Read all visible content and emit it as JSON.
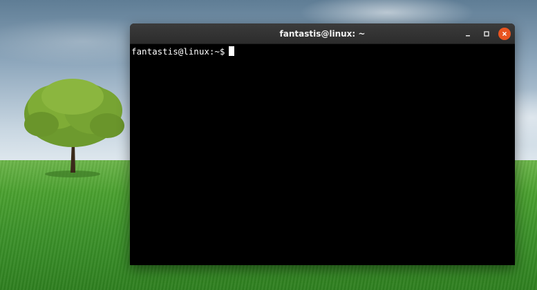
{
  "window": {
    "title": "fantastis@linux: ~",
    "controls": {
      "minimize_icon": "minimize-icon",
      "maximize_icon": "maximize-icon",
      "close_icon": "close-icon"
    },
    "close_color": "#e95420"
  },
  "terminal": {
    "prompt": "fantastis@linux:~$"
  }
}
